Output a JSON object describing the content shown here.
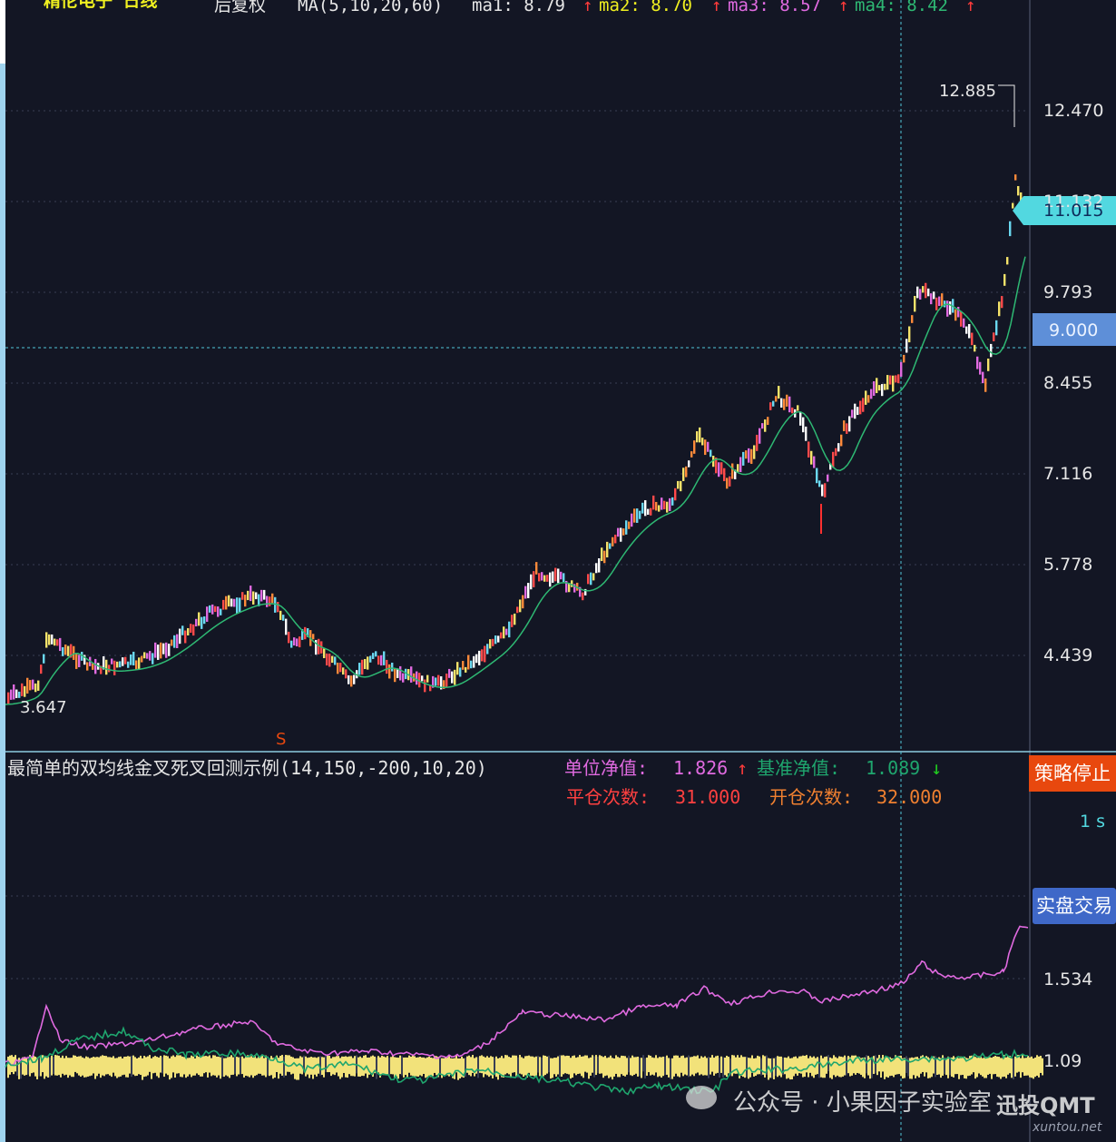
{
  "header": {
    "stock_name": "精伦电子 日线",
    "adjust": "后复权",
    "ma_label": "MA(5,10,20,60)",
    "ma1": "ma1: 8.79",
    "ma2": "ma2: 8.70",
    "ma3": "ma3: 8.57",
    "ma4": "ma4: 8.42",
    "arrow_up": "↑"
  },
  "price_axis": {
    "ticks": [
      "12.470",
      "11.132",
      "9.793",
      "8.455",
      "7.116",
      "5.778",
      "4.439"
    ],
    "current_price": "11.015",
    "crosshair_price": "9.000",
    "high_label": "12.885",
    "low_label": "3.647"
  },
  "signal_marker": "S",
  "strategy": {
    "title": "最简单的双均线金叉死叉回测示例(14,150,-200,10,20)",
    "unit_nav_label": "单位净值:",
    "unit_nav_value": "1.826",
    "bench_nav_label": "基准净值:",
    "bench_nav_value": "1.089",
    "close_count_label": "平仓次数:",
    "close_count_value": "31.000",
    "open_count_label": "开仓次数:",
    "open_count_value": "32.000",
    "arrow_up": "↑",
    "arrow_down": "↓"
  },
  "lower_axis": {
    "ticks": [
      "1.534",
      "1.09"
    ],
    "interval": "1 s"
  },
  "buttons": {
    "stop": "策略停止",
    "live": "实盘交易"
  },
  "watermark": {
    "text": "公众号 · 小果因子实验室",
    "brand": "迅投QMT",
    "domain": "xuntou.net"
  },
  "colors": {
    "background": "#131624",
    "grid": "#3a3f55",
    "ma_green": "#2eb873",
    "nav_pink": "#e06ae0",
    "bench_green": "#1fa66e",
    "crosshair": "#52c6d8",
    "stop_btn": "#e8480e",
    "live_btn": "#3f68c8"
  },
  "chart_data": {
    "type": "line",
    "series": [
      {
        "name": "单位净值",
        "x": [
          0,
          30,
          45,
          60,
          90,
          150,
          210,
          270,
          300,
          330,
          360,
          400,
          450,
          500,
          530,
          570,
          620,
          660,
          700,
          740,
          770,
          800,
          850,
          880,
          900,
          920,
          960,
          990,
          1010,
          1030,
          1060,
          1100,
          1115,
          1130
        ],
        "y": [
          1.07,
          1.1,
          1.4,
          1.2,
          1.16,
          1.19,
          1.26,
          1.3,
          1.18,
          1.14,
          1.13,
          1.14,
          1.12,
          1.11,
          1.18,
          1.35,
          1.33,
          1.31,
          1.38,
          1.39,
          1.48,
          1.4,
          1.47,
          1.46,
          1.41,
          1.43,
          1.47,
          1.51,
          1.62,
          1.55,
          1.54,
          1.57,
          1.8,
          1.82
        ]
      },
      {
        "name": "基准净值",
        "x": [
          0,
          40,
          80,
          130,
          160,
          200,
          250,
          300,
          330,
          380,
          430,
          460,
          520,
          570,
          620,
          680,
          720,
          780,
          800,
          820,
          880,
          940,
          1000,
          1050,
          1100,
          1130
        ],
        "y": [
          1.07,
          1.1,
          1.2,
          1.25,
          1.16,
          1.12,
          1.13,
          1.1,
          1.04,
          1.07,
          0.99,
          0.98,
          1.04,
          1.0,
          0.97,
          0.92,
          0.95,
          0.92,
          1.02,
          1.03,
          1.05,
          1.09,
          1.1,
          1.1,
          1.12,
          1.13
        ]
      }
    ],
    "price_axis_range": [
      3.647,
      12.885
    ]
  }
}
